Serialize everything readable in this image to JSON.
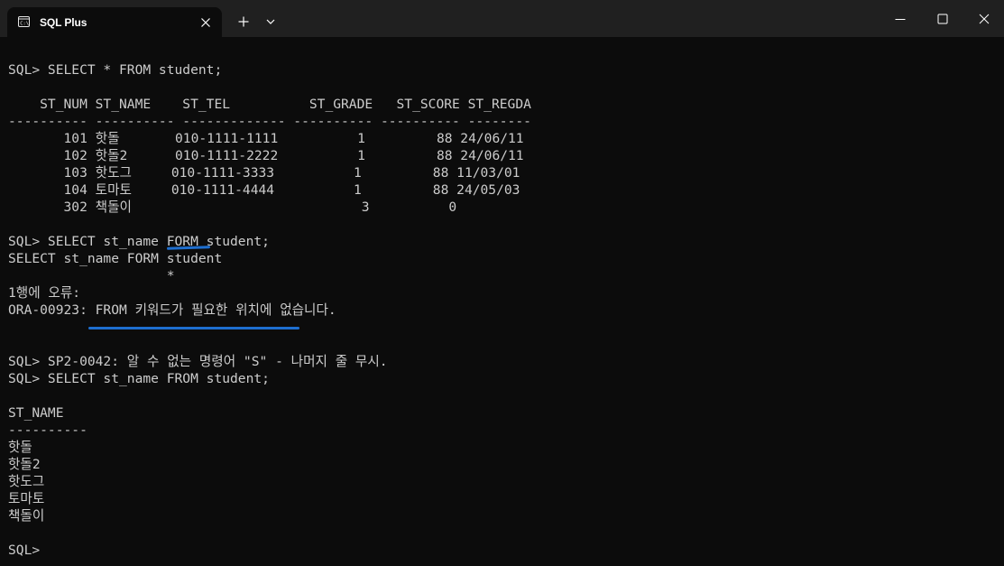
{
  "window": {
    "tab_title": "SQL Plus",
    "icons": {
      "tab": "terminal-app-icon",
      "close_tab": "close-icon",
      "new_tab": "plus-icon",
      "dropdown": "chevron-down-icon",
      "minimize": "minimize-icon",
      "maximize": "maximize-icon",
      "close_window": "close-icon"
    }
  },
  "terminal": {
    "lines": [
      "SQL> SELECT * FROM student;",
      "",
      "    ST_NUM ST_NAME    ST_TEL          ST_GRADE   ST_SCORE ST_REGDA",
      "---------- ---------- ------------- ---------- ---------- --------",
      "       101 핫돌       010-1111-1111          1         88 24/06/11",
      "       102 핫돌2      010-1111-2222          1         88 24/06/11",
      "       103 핫도그     010-1111-3333          1         88 11/03/01",
      "       104 토마토     010-1111-4444          1         88 24/05/03",
      "       302 책돌이                             3          0",
      "",
      "SQL> SELECT st_name FORM student;",
      "SELECT st_name FORM student",
      "                    *",
      "1행에 오류:",
      "ORA-00923: FROM 키워드가 필요한 위치에 없습니다.",
      "",
      "",
      "SQL> SP2-0042: 알 수 없는 명령어 \"S\" - 나머지 줄 무시.",
      "SQL> SELECT st_name FROM student;",
      "",
      "ST_NAME",
      "----------",
      "핫돌",
      "핫돌2",
      "핫도그",
      "토마토",
      "책돌이",
      "",
      "SQL>"
    ]
  },
  "colors": {
    "terminal_bg": "#0c0c0c",
    "titlebar_bg": "#202020",
    "text": "#cccccc",
    "annotation": "#1e6fd0"
  }
}
